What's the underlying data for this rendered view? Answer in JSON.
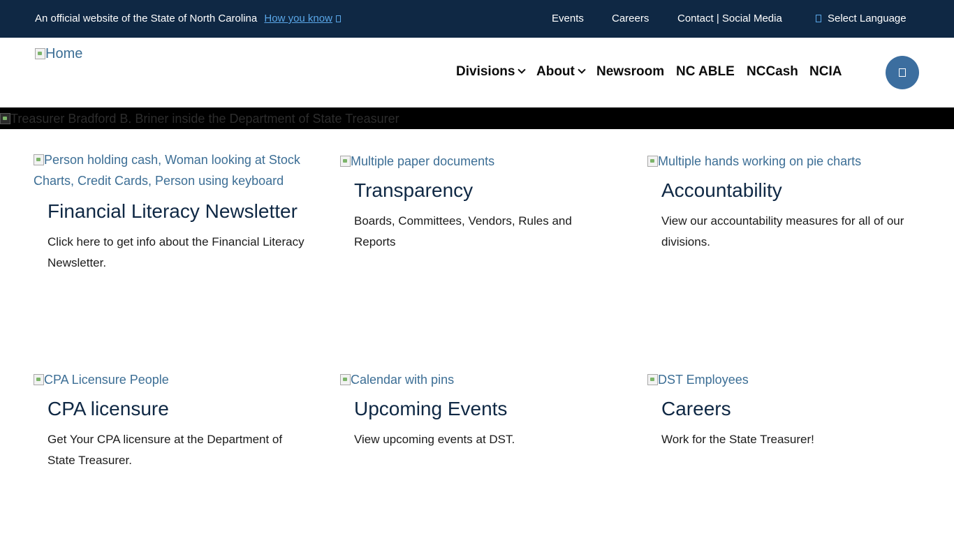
{
  "top_bar": {
    "official_text": "An official website of the State of North Carolina",
    "how_you_know": "How you know",
    "links": {
      "events": "Events",
      "careers": "Careers",
      "contact": "Contact | Social Media",
      "language": "Select Language"
    }
  },
  "header": {
    "logo_alt": "Home",
    "nav": {
      "divisions": "Divisions",
      "about": "About",
      "newsroom": "Newsroom",
      "nc_able": "NC ABLE",
      "nccash": "NCCash",
      "ncia": "NCIA"
    }
  },
  "hero": {
    "image_alt": "Treasurer Bradford B. Briner inside the Department of State Treasurer"
  },
  "cards": [
    {
      "image_alt": "Person holding cash, Woman looking at Stock Charts, Credit Cards, Person using keyboard",
      "title": "Financial Literacy Newsletter",
      "description": "Click here to get info about the Financial Literacy Newsletter."
    },
    {
      "image_alt": "Multiple paper documents",
      "title": "Transparency",
      "description": "Boards, Committees, Vendors, Rules and Reports"
    },
    {
      "image_alt": "Multiple hands working on pie charts",
      "title": "Accountability",
      "description": "View our accountability measures for all of our divisions."
    },
    {
      "image_alt": "CPA Licensure People",
      "title": "CPA licensure",
      "description": "Get Your CPA licensure at the Department of State Treasurer."
    },
    {
      "image_alt": "Calendar with pins",
      "title": "Upcoming Events",
      "description": "View upcoming events at DST."
    },
    {
      "image_alt": "DST Employees",
      "title": "Careers",
      "description": "Work for the State Treasurer!"
    }
  ],
  "colors": {
    "top_bar_bg": "#0f2844",
    "link_blue": "#5aa7e8",
    "alt_text_blue": "#3c6e95",
    "search_button": "#3c6e9f",
    "heading_navy": "#0f2844"
  },
  "icons": {
    "how_you_know": "lock-box-icon",
    "language": "globe-icon",
    "search": "search-icon",
    "nav_dropdown": "chevron-down-icon",
    "broken_image": "broken-image-icon"
  }
}
